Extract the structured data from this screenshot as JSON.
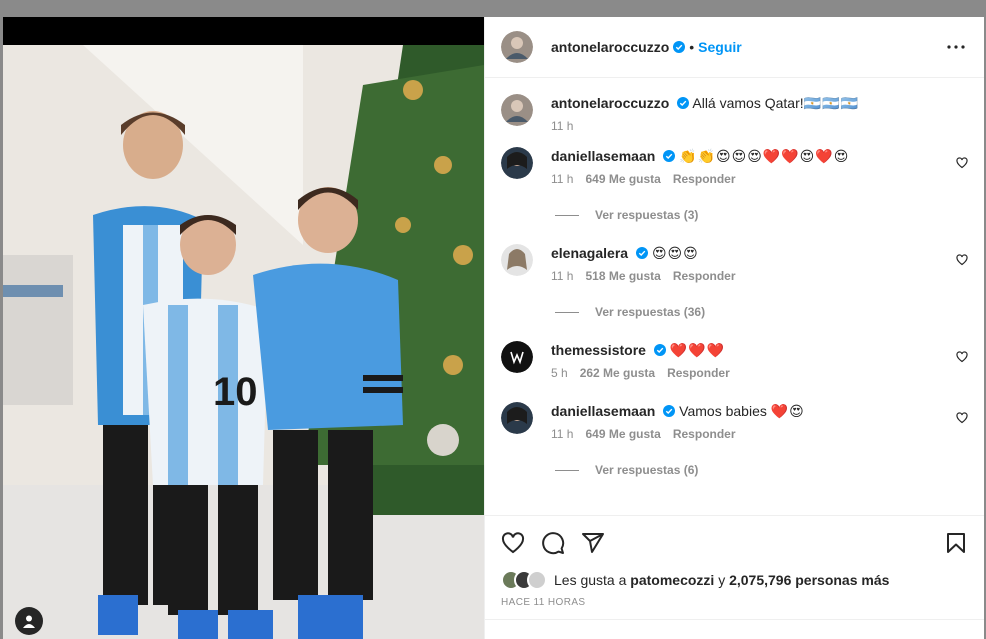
{
  "post": {
    "author": "antonelaroccuzzo",
    "follow_label": "Seguir",
    "dot": "•",
    "caption": "Allá vamos Qatar!",
    "caption_emoji": "🇦🇷🇦🇷🇦🇷",
    "caption_time": "11 h"
  },
  "comments": [
    {
      "user": "daniellasemaan",
      "emoji": "👏👏😍😍😍❤️❤️😍❤️😍",
      "text": "",
      "time": "11 h",
      "likes": "649 Me gusta",
      "reply_label": "Responder",
      "replies": "Ver respuestas (3)",
      "avatar_color": "#2b3a4a"
    },
    {
      "user": "elenagalera",
      "emoji": "😍😍😍",
      "text": "",
      "time": "11 h",
      "likes": "518 Me gusta",
      "reply_label": "Responder",
      "replies": "Ver respuestas (36)",
      "avatar_color": "#d8d8d8"
    },
    {
      "user": "themessistore",
      "emoji": "❤️❤️❤️",
      "text": "",
      "time": "5 h",
      "likes": "262 Me gusta",
      "reply_label": "Responder",
      "replies": "",
      "avatar_color": "#111111"
    },
    {
      "user": "daniellasemaan",
      "emoji": "❤️😍",
      "text": "Vamos babies ",
      "time": "11 h",
      "likes": "649 Me gusta",
      "reply_label": "Responder",
      "replies": "Ver respuestas (6)",
      "avatar_color": "#2b3a4a"
    }
  ],
  "likes_line": {
    "prefix": "Les gusta a ",
    "user": "patomecozzi",
    "middle": " y ",
    "count": "2,075,796 personas más"
  },
  "posted_ago": "HACE 11 HORAS",
  "colors": {
    "accent": "#0095f6",
    "verified": "#0095f6",
    "muted": "#8e8e8e"
  },
  "icons": [
    "verified-badge-icon",
    "more-options-icon",
    "heart-icon",
    "comment-icon",
    "share-icon",
    "save-icon",
    "user-tag-icon"
  ]
}
